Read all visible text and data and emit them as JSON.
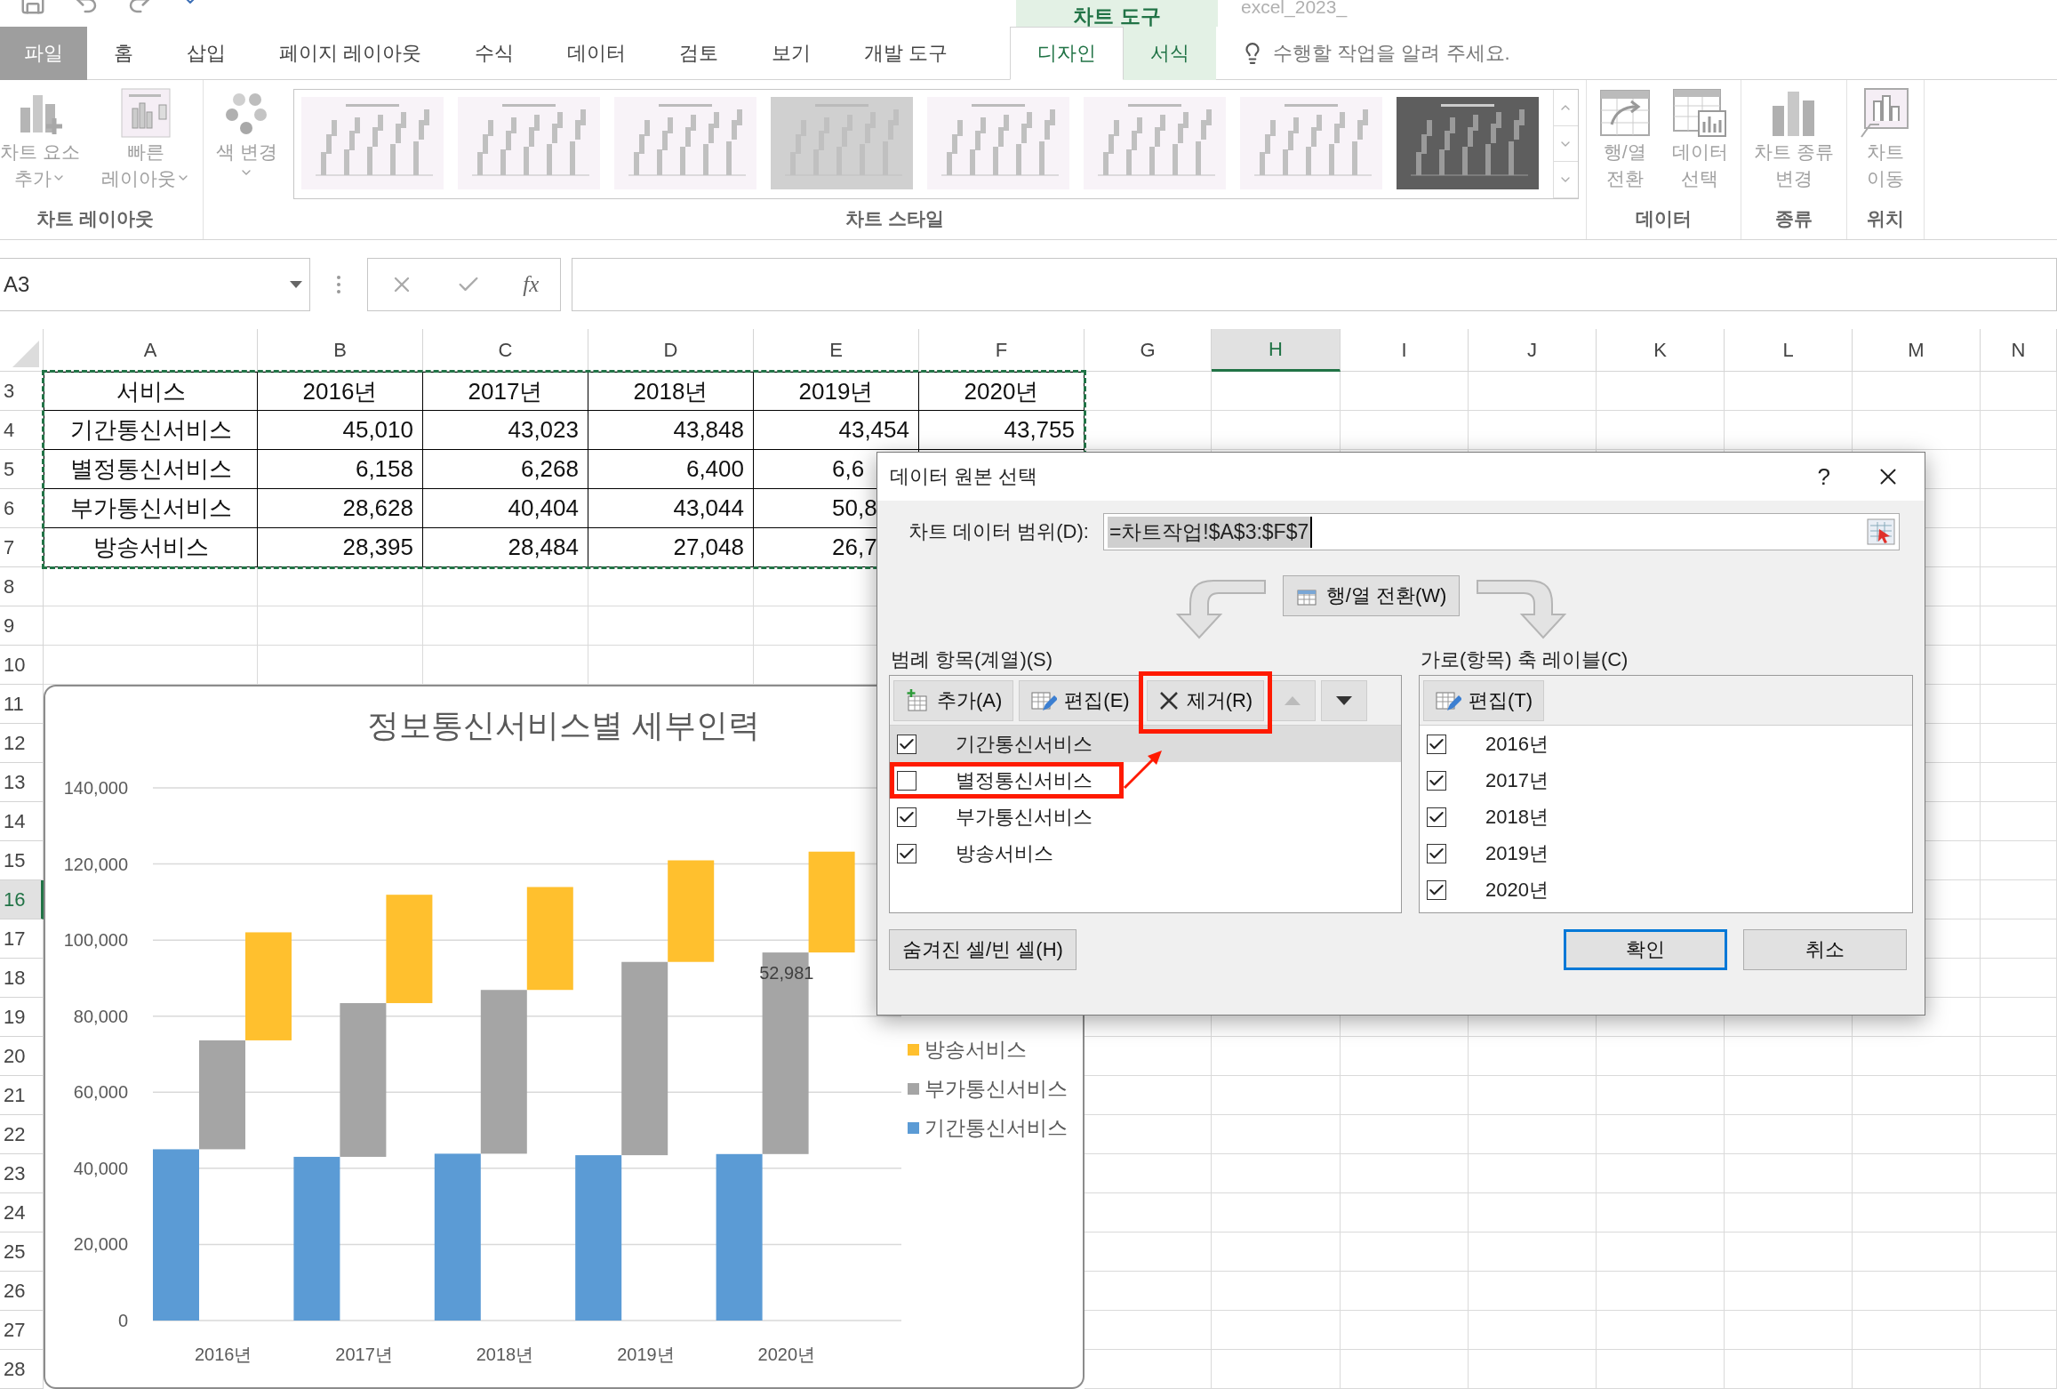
{
  "title_bar": {
    "context_header": "차트 도구",
    "file_title": "excel_2023_"
  },
  "tabs": [
    {
      "label": "파일",
      "kind": "file",
      "selected": false
    },
    {
      "label": "홈",
      "kind": "normal",
      "selected": false
    },
    {
      "label": "삽입",
      "kind": "normal",
      "selected": false
    },
    {
      "label": "페이지 레이아웃",
      "kind": "normal",
      "selected": false
    },
    {
      "label": "수식",
      "kind": "normal",
      "selected": false
    },
    {
      "label": "데이터",
      "kind": "normal",
      "selected": false
    },
    {
      "label": "검토",
      "kind": "normal",
      "selected": false
    },
    {
      "label": "보기",
      "kind": "normal",
      "selected": false
    },
    {
      "label": "개발 도구",
      "kind": "normal",
      "selected": false
    },
    {
      "label": "디자인",
      "kind": "contextual",
      "selected": true
    },
    {
      "label": "서식",
      "kind": "contextual",
      "selected": false
    }
  ],
  "tell_me": "수행할 작업을 알려 주세요.",
  "ribbon": {
    "groups": [
      {
        "label": "차트 레이아웃",
        "items": [
          {
            "kind": "button",
            "lines": [
              "차트 요소",
              "추가"
            ],
            "caret": true
          },
          {
            "kind": "button",
            "lines": [
              "빠른",
              "레이아웃"
            ],
            "caret": true
          }
        ]
      },
      {
        "label": "차트 스타일",
        "items": [
          {
            "kind": "button",
            "lines": [
              "색 변경"
            ],
            "caret": true
          },
          {
            "kind": "gallery",
            "thumbnails": [
              {
                "kind": "light"
              },
              {
                "kind": "light"
              },
              {
                "kind": "light"
              },
              {
                "kind": "gray"
              },
              {
                "kind": "light"
              },
              {
                "kind": "light"
              },
              {
                "kind": "light"
              },
              {
                "kind": "dark"
              }
            ]
          }
        ]
      },
      {
        "label": "데이터",
        "items": [
          {
            "kind": "button",
            "lines": [
              "행/열",
              "전환"
            ],
            "caret": false
          },
          {
            "kind": "button",
            "lines": [
              "데이터",
              "선택"
            ],
            "caret": false
          }
        ]
      },
      {
        "label": "종류",
        "items": [
          {
            "kind": "button",
            "lines": [
              "차트 종류",
              "변경"
            ],
            "caret": false
          }
        ]
      },
      {
        "label": "위치",
        "items": [
          {
            "kind": "button",
            "lines": [
              "차트",
              "이동"
            ],
            "caret": false
          }
        ]
      }
    ]
  },
  "formula_bar": {
    "name_box": "A3",
    "function_label": "fx"
  },
  "sheet": {
    "copy_marquee": true,
    "columns": [
      {
        "label": "A",
        "selected": false
      },
      {
        "label": "B",
        "selected": false
      },
      {
        "label": "C",
        "selected": false
      },
      {
        "label": "D",
        "selected": false
      },
      {
        "label": "E",
        "selected": false
      },
      {
        "label": "F",
        "selected": false
      },
      {
        "label": "G",
        "selected": false
      },
      {
        "label": "H",
        "selected": true
      },
      {
        "label": "I",
        "selected": false
      },
      {
        "label": "J",
        "selected": false
      },
      {
        "label": "K",
        "selected": false
      },
      {
        "label": "L",
        "selected": false
      },
      {
        "label": "M",
        "selected": false
      },
      {
        "label": "N",
        "selected": false
      }
    ],
    "rows": [
      {
        "label": "3",
        "selected": false,
        "cells": [
          {
            "text": "서비스"
          },
          {
            "text": "2016년"
          },
          {
            "text": "2017년"
          },
          {
            "text": "2018년"
          },
          {
            "text": "2019년"
          },
          {
            "text": "2020년"
          }
        ]
      },
      {
        "label": "4",
        "selected": false,
        "cells": [
          {
            "text": "기간통신서비스"
          },
          {
            "text": "45,010"
          },
          {
            "text": "43,023"
          },
          {
            "text": "43,848"
          },
          {
            "text": "43,454"
          },
          {
            "text": "43,755"
          }
        ]
      },
      {
        "label": "5",
        "selected": false,
        "cells": [
          {
            "text": "별정통신서비스"
          },
          {
            "text": "6,158"
          },
          {
            "text": "6,268"
          },
          {
            "text": "6,400"
          },
          {
            "text": "6,6",
            "cut": true
          }
        ]
      },
      {
        "label": "6",
        "selected": false,
        "cells": [
          {
            "text": "부가통신서비스"
          },
          {
            "text": "28,628"
          },
          {
            "text": "40,404"
          },
          {
            "text": "43,044"
          },
          {
            "text": "50,8",
            "cut": true
          }
        ]
      },
      {
        "label": "7",
        "selected": false,
        "cells": [
          {
            "text": "방송서비스"
          },
          {
            "text": "28,395"
          },
          {
            "text": "28,484"
          },
          {
            "text": "27,048"
          },
          {
            "text": "26,7",
            "cut": true
          }
        ]
      },
      {
        "label": "8",
        "selected": false
      },
      {
        "label": "9",
        "selected": false
      },
      {
        "label": "10",
        "selected": false
      },
      {
        "label": "11",
        "selected": false
      },
      {
        "label": "12",
        "selected": false
      },
      {
        "label": "13",
        "selected": false
      },
      {
        "label": "14",
        "selected": false
      },
      {
        "label": "15",
        "selected": false
      },
      {
        "label": "16",
        "selected": true
      },
      {
        "label": "17",
        "selected": false
      },
      {
        "label": "18",
        "selected": false
      },
      {
        "label": "19",
        "selected": false
      },
      {
        "label": "20",
        "selected": false
      },
      {
        "label": "21",
        "selected": false
      },
      {
        "label": "22",
        "selected": false
      },
      {
        "label": "23",
        "selected": false
      },
      {
        "label": "24",
        "selected": false
      },
      {
        "label": "25",
        "selected": false
      },
      {
        "label": "26",
        "selected": false
      },
      {
        "label": "27",
        "selected": false
      },
      {
        "label": "28",
        "selected": false
      }
    ]
  },
  "chart": {
    "title": "정보통신서비스별 세부인력",
    "chart_data": {
      "type": "bar",
      "stacked": true,
      "orientation": "vertical",
      "categories": [
        "2016년",
        "2017년",
        "2018년",
        "2019년",
        "2020년"
      ],
      "series": [
        {
          "name": "기간통신서비스",
          "color": "#5b9bd5",
          "values": [
            45010,
            43023,
            43848,
            43454,
            43755
          ]
        },
        {
          "name": "부가통신서비스",
          "color": "#a5a5a5",
          "values": [
            28628,
            40404,
            43044,
            50800,
            52981
          ]
        },
        {
          "name": "방송서비스",
          "color": "#ffc02e",
          "values": [
            28395,
            28484,
            27048,
            26700,
            26500
          ]
        }
      ],
      "ylim": [
        0,
        140000
      ],
      "yticks": [
        {
          "value": 0,
          "label": "0"
        },
        {
          "value": 20000,
          "label": "20,000"
        },
        {
          "value": 40000,
          "label": "40,000"
        },
        {
          "value": 60000,
          "label": "60,000"
        },
        {
          "value": 80000,
          "label": "80,000"
        },
        {
          "value": 100000,
          "label": "100,000"
        },
        {
          "value": 120000,
          "label": "120,000"
        },
        {
          "value": 140000,
          "label": "140,000"
        }
      ],
      "grid": true,
      "annotations": [
        {
          "x": "2020년",
          "y": 96736,
          "text": "52,981"
        }
      ]
    }
  },
  "dialog": {
    "title": "데이터 원본 선택",
    "help": "?",
    "range_label": "차트 데이터 범위(D):",
    "range_value": "=차트작업!$A$3:$F$7",
    "switch_button": "행/열 전환(W)",
    "legend_panel": {
      "heading": "범례 항목(계열)(S)",
      "buttons": [
        {
          "label": "추가(A)",
          "highlighted": false
        },
        {
          "label": "편집(E)",
          "highlighted": false
        },
        {
          "label": "제거(R)",
          "highlighted": true
        }
      ],
      "arrows": [
        {
          "kind": "up",
          "disabled": true
        },
        {
          "kind": "down",
          "disabled": false
        }
      ],
      "items": [
        {
          "label": "기간통신서비스",
          "checked": true,
          "selected": true,
          "highlighted": false
        },
        {
          "label": "별정통신서비스",
          "checked": false,
          "selected": false,
          "highlighted": true
        },
        {
          "label": "부가통신서비스",
          "checked": true,
          "selected": false,
          "highlighted": false
        },
        {
          "label": "방송서비스",
          "checked": true,
          "selected": false,
          "highlighted": false
        }
      ]
    },
    "axis_panel": {
      "heading": "가로(항목) 축 레이블(C)",
      "buttons": [
        {
          "label": "편집(T)",
          "highlighted": false
        }
      ],
      "items": [
        {
          "label": "2016년",
          "checked": true,
          "selected": false,
          "highlighted": false
        },
        {
          "label": "2017년",
          "checked": true,
          "selected": false,
          "highlighted": false
        },
        {
          "label": "2018년",
          "checked": true,
          "selected": false,
          "highlighted": false
        },
        {
          "label": "2019년",
          "checked": true,
          "selected": false,
          "highlighted": false
        },
        {
          "label": "2020년",
          "checked": true,
          "selected": false,
          "highlighted": false
        }
      ]
    },
    "hidden_cells_button": "숨겨진 셀/빈 셀(H)",
    "buttons": [
      {
        "label": "확인",
        "default": true
      },
      {
        "label": "취소",
        "default": false
      }
    ]
  }
}
